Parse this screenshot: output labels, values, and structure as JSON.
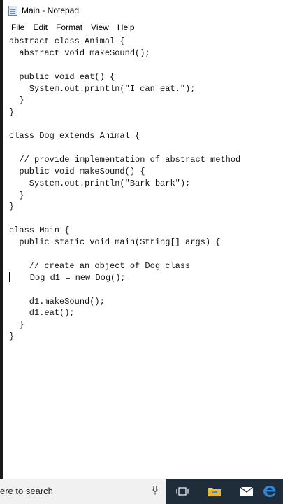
{
  "window": {
    "title": "Main - Notepad"
  },
  "menu": [
    "File",
    "Edit",
    "Format",
    "View",
    "Help"
  ],
  "editor": {
    "lines": [
      "abstract class Animal {",
      "  abstract void makeSound();",
      "",
      "  public void eat() {",
      "    System.out.println(\"I can eat.\");",
      "  }",
      "}",
      "",
      "class Dog extends Animal {",
      "",
      "  // provide implementation of abstract method",
      "  public void makeSound() {",
      "    System.out.println(\"Bark bark\");",
      "  }",
      "}",
      "",
      "class Main {",
      "  public static void main(String[] args) {",
      "",
      "    // create an object of Dog class",
      "    Dog d1 = new Dog();",
      "",
      "    d1.makeSound();",
      "    d1.eat();",
      "  }",
      "}"
    ]
  },
  "taskbar": {
    "search_placeholder": "ere to search",
    "icons": [
      "mic-icon",
      "task-view-icon",
      "file-explorer-icon",
      "mail-icon",
      "edge-icon"
    ]
  },
  "colors": {
    "taskbar": "#1f2d3a",
    "search_box": "#f1f1f1",
    "folder": "#f4c842",
    "edge": "#2f86d8"
  }
}
